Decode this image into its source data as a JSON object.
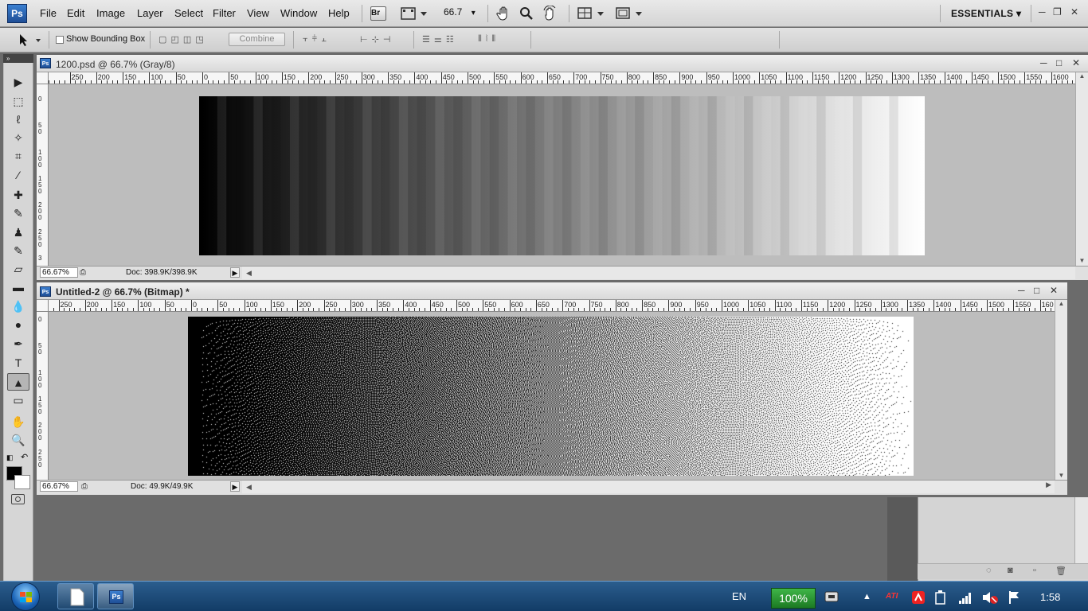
{
  "app": {
    "logo": "Ps",
    "workspace": "ESSENTIALS ▾"
  },
  "menu": [
    "File",
    "Edit",
    "Image",
    "Layer",
    "Select",
    "Filter",
    "View",
    "Window",
    "Help"
  ],
  "appbar": {
    "bridge": "Br",
    "zoom": "66.7",
    "zoom_arrow": "▾",
    "min": "─",
    "restore": "❐",
    "close": "✕"
  },
  "options": {
    "show_bounding_box": "Show Bounding Box",
    "combine": "Combine"
  },
  "tools": [
    "move-tool",
    "marquee-tool",
    "lasso-tool",
    "magic-wand-tool",
    "crop-tool",
    "eyedropper-tool",
    "healing-tool",
    "brush-tool",
    "clone-stamp-tool",
    "history-brush-tool",
    "eraser-tool",
    "gradient-tool",
    "blur-tool",
    "dodge-tool",
    "pen-tool",
    "type-tool",
    "path-selection-tool",
    "shape-tool",
    "hand-tool",
    "zoom-tool"
  ],
  "tool_glyphs": [
    "▶",
    "⬚",
    "ℓ",
    "✧",
    "⌗",
    "⁄",
    "✚",
    "✎",
    "♟",
    "✎",
    "▱",
    "▬",
    "💧",
    "●",
    "✒",
    "T",
    "▲",
    "▭",
    "✋",
    "🔍"
  ],
  "colors": {
    "foreground": "#000000",
    "background": "#ffffff"
  },
  "doc1": {
    "title": "1200.psd @ 66.7% (Gray/8)",
    "zoom": "66.67%",
    "doc_size": "Doc: 398.9K/398.9K",
    "ruler_neg": [
      "250",
      "200",
      "150",
      "100",
      "50"
    ],
    "ruler_pos": [
      "0",
      "50",
      "100",
      "150",
      "200",
      "250",
      "300",
      "350",
      "400",
      "450",
      "500",
      "550",
      "600",
      "650",
      "700",
      "750",
      "800",
      "850",
      "900",
      "950",
      "1000",
      "1050",
      "1100",
      "1150",
      "1200",
      "1250",
      "1300",
      "1350",
      "1400",
      "1450",
      "1500",
      "1550",
      "1600"
    ],
    "vruler": [
      "0",
      "5\n0",
      "1\n0\n0",
      "1\n5\n0",
      "2\n0\n0",
      "2\n5\n0",
      "3"
    ]
  },
  "doc2": {
    "title": "Untitled-2 @ 66.7% (Bitmap) *",
    "zoom": "66.67%",
    "doc_size": "Doc: 49.9K/49.9K",
    "ruler_neg": [
      "250",
      "200",
      "150",
      "100",
      "50"
    ],
    "ruler_pos": [
      "0",
      "50",
      "100",
      "150",
      "200",
      "250",
      "300",
      "350",
      "400",
      "450",
      "500",
      "550",
      "600",
      "650",
      "700",
      "750",
      "800",
      "850",
      "900",
      "950",
      "1000",
      "1050",
      "1100",
      "1150",
      "1200",
      "1250",
      "1300",
      "1350",
      "1400",
      "1450",
      "1500",
      "1550",
      "160"
    ],
    "vruler": [
      "0",
      "5\n0",
      "1\n0\n0",
      "1\n5\n0",
      "2\n0\n0",
      "2\n5\n0"
    ]
  },
  "taskbar": {
    "lang": "EN",
    "battery": "100%",
    "clock": "1:58",
    "ati": "ATI"
  }
}
